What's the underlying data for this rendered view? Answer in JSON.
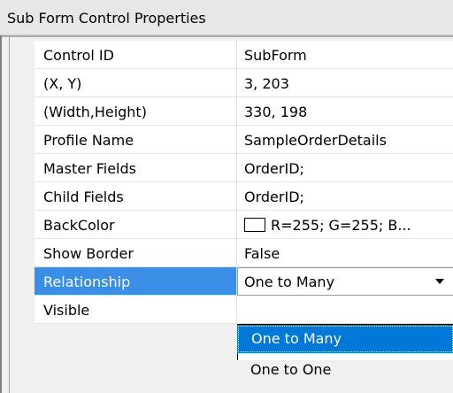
{
  "window": {
    "title": "Sub Form Control Properties"
  },
  "properties": [
    {
      "name": "Control ID",
      "value": "SubForm"
    },
    {
      "name": "(X, Y)",
      "value": "3, 203"
    },
    {
      "name": "(Width,Height)",
      "value": "330, 198"
    },
    {
      "name": "Profile Name",
      "value": "SampleOrderDetails"
    },
    {
      "name": "Master Fields",
      "value": "OrderID;"
    },
    {
      "name": "Child Fields",
      "value": "OrderID;"
    },
    {
      "name": "BackColor",
      "value": "R=255; G=255; B..."
    },
    {
      "name": "Show Border",
      "value": "False"
    },
    {
      "name": "Relationship",
      "value": "One to Many"
    },
    {
      "name": "Visible",
      "value": ""
    }
  ],
  "dropdown": {
    "options": [
      "One to Many",
      "One to One"
    ],
    "highlighted": "One to Many"
  },
  "colors": {
    "selection": "#3b8ee6",
    "highlight": "#0078d7",
    "swatch": "#ffffff"
  }
}
